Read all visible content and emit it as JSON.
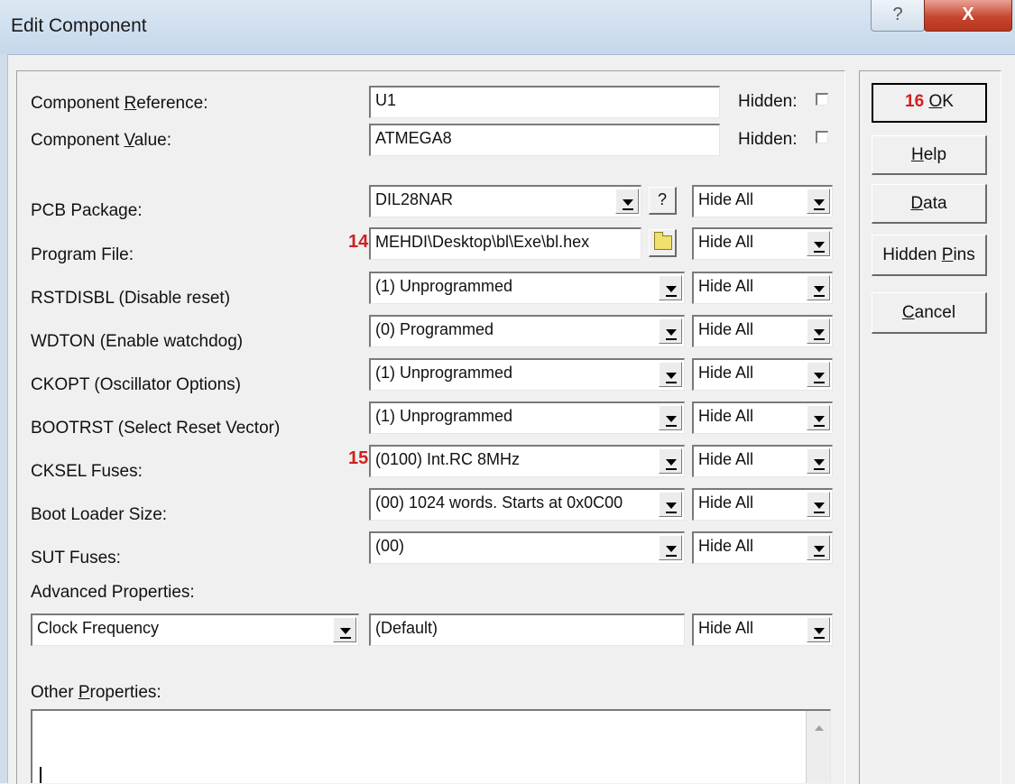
{
  "window": {
    "title": "Edit Component",
    "help_glyph": "?",
    "close_glyph": "X"
  },
  "fields": {
    "reference": {
      "prefix": "Component ",
      "mnemonic": "R",
      "suffix": "eference:",
      "value": "U1",
      "hidden_label": "Hidden:"
    },
    "value": {
      "prefix": "Component ",
      "mnemonic": "V",
      "suffix": "alue:",
      "value": "ATMEGA8",
      "hidden_label": "Hidden:"
    },
    "pcb_package": {
      "label": "PCB Package:",
      "value": "DIL28NAR",
      "help_button": "?",
      "visibility": "Hide All"
    },
    "program_file": {
      "label": "Program File:",
      "marker": "14",
      "value": "MEHDI\\Desktop\\bl\\Exe\\bl.hex",
      "visibility": "Hide All"
    },
    "rstdisbl": {
      "label": "RSTDISBL (Disable reset)",
      "value": "(1) Unprogrammed",
      "visibility": "Hide All"
    },
    "wdton": {
      "label": "WDTON (Enable watchdog)",
      "value": "(0) Programmed",
      "visibility": "Hide All"
    },
    "ckopt": {
      "label": "CKOPT (Oscillator Options)",
      "value": "(1) Unprogrammed",
      "visibility": "Hide All"
    },
    "bootrst": {
      "label": "BOOTRST (Select Reset Vector)",
      "value": "(1) Unprogrammed",
      "visibility": "Hide All"
    },
    "cksel": {
      "label": "CKSEL Fuses:",
      "marker": "15",
      "value": "(0100) Int.RC 8MHz",
      "visibility": "Hide All"
    },
    "boot_loader_size": {
      "label": "Boot Loader Size:",
      "value": "(00) 1024 words. Starts at 0x0C00",
      "visibility": "Hide All"
    },
    "sut": {
      "label": "SUT Fuses:",
      "value": "(00)",
      "visibility": "Hide All"
    }
  },
  "advanced": {
    "label": "Advanced Properties:",
    "property": "Clock Frequency",
    "value": "(Default)",
    "visibility": "Hide All"
  },
  "other": {
    "prefix": "Other ",
    "mnemonic": "P",
    "suffix": "roperties:"
  },
  "buttons": {
    "ok": {
      "marker": "16",
      "mnemonic": "O",
      "rest": "K"
    },
    "help": {
      "mnemonic": "H",
      "rest": "elp"
    },
    "data": {
      "mnemonic": "D",
      "rest": "ata"
    },
    "hidden_pins": {
      "before": "Hidden ",
      "mnemonic": "P",
      "rest": "ins"
    },
    "cancel": {
      "mnemonic": "C",
      "rest": "ancel"
    }
  }
}
